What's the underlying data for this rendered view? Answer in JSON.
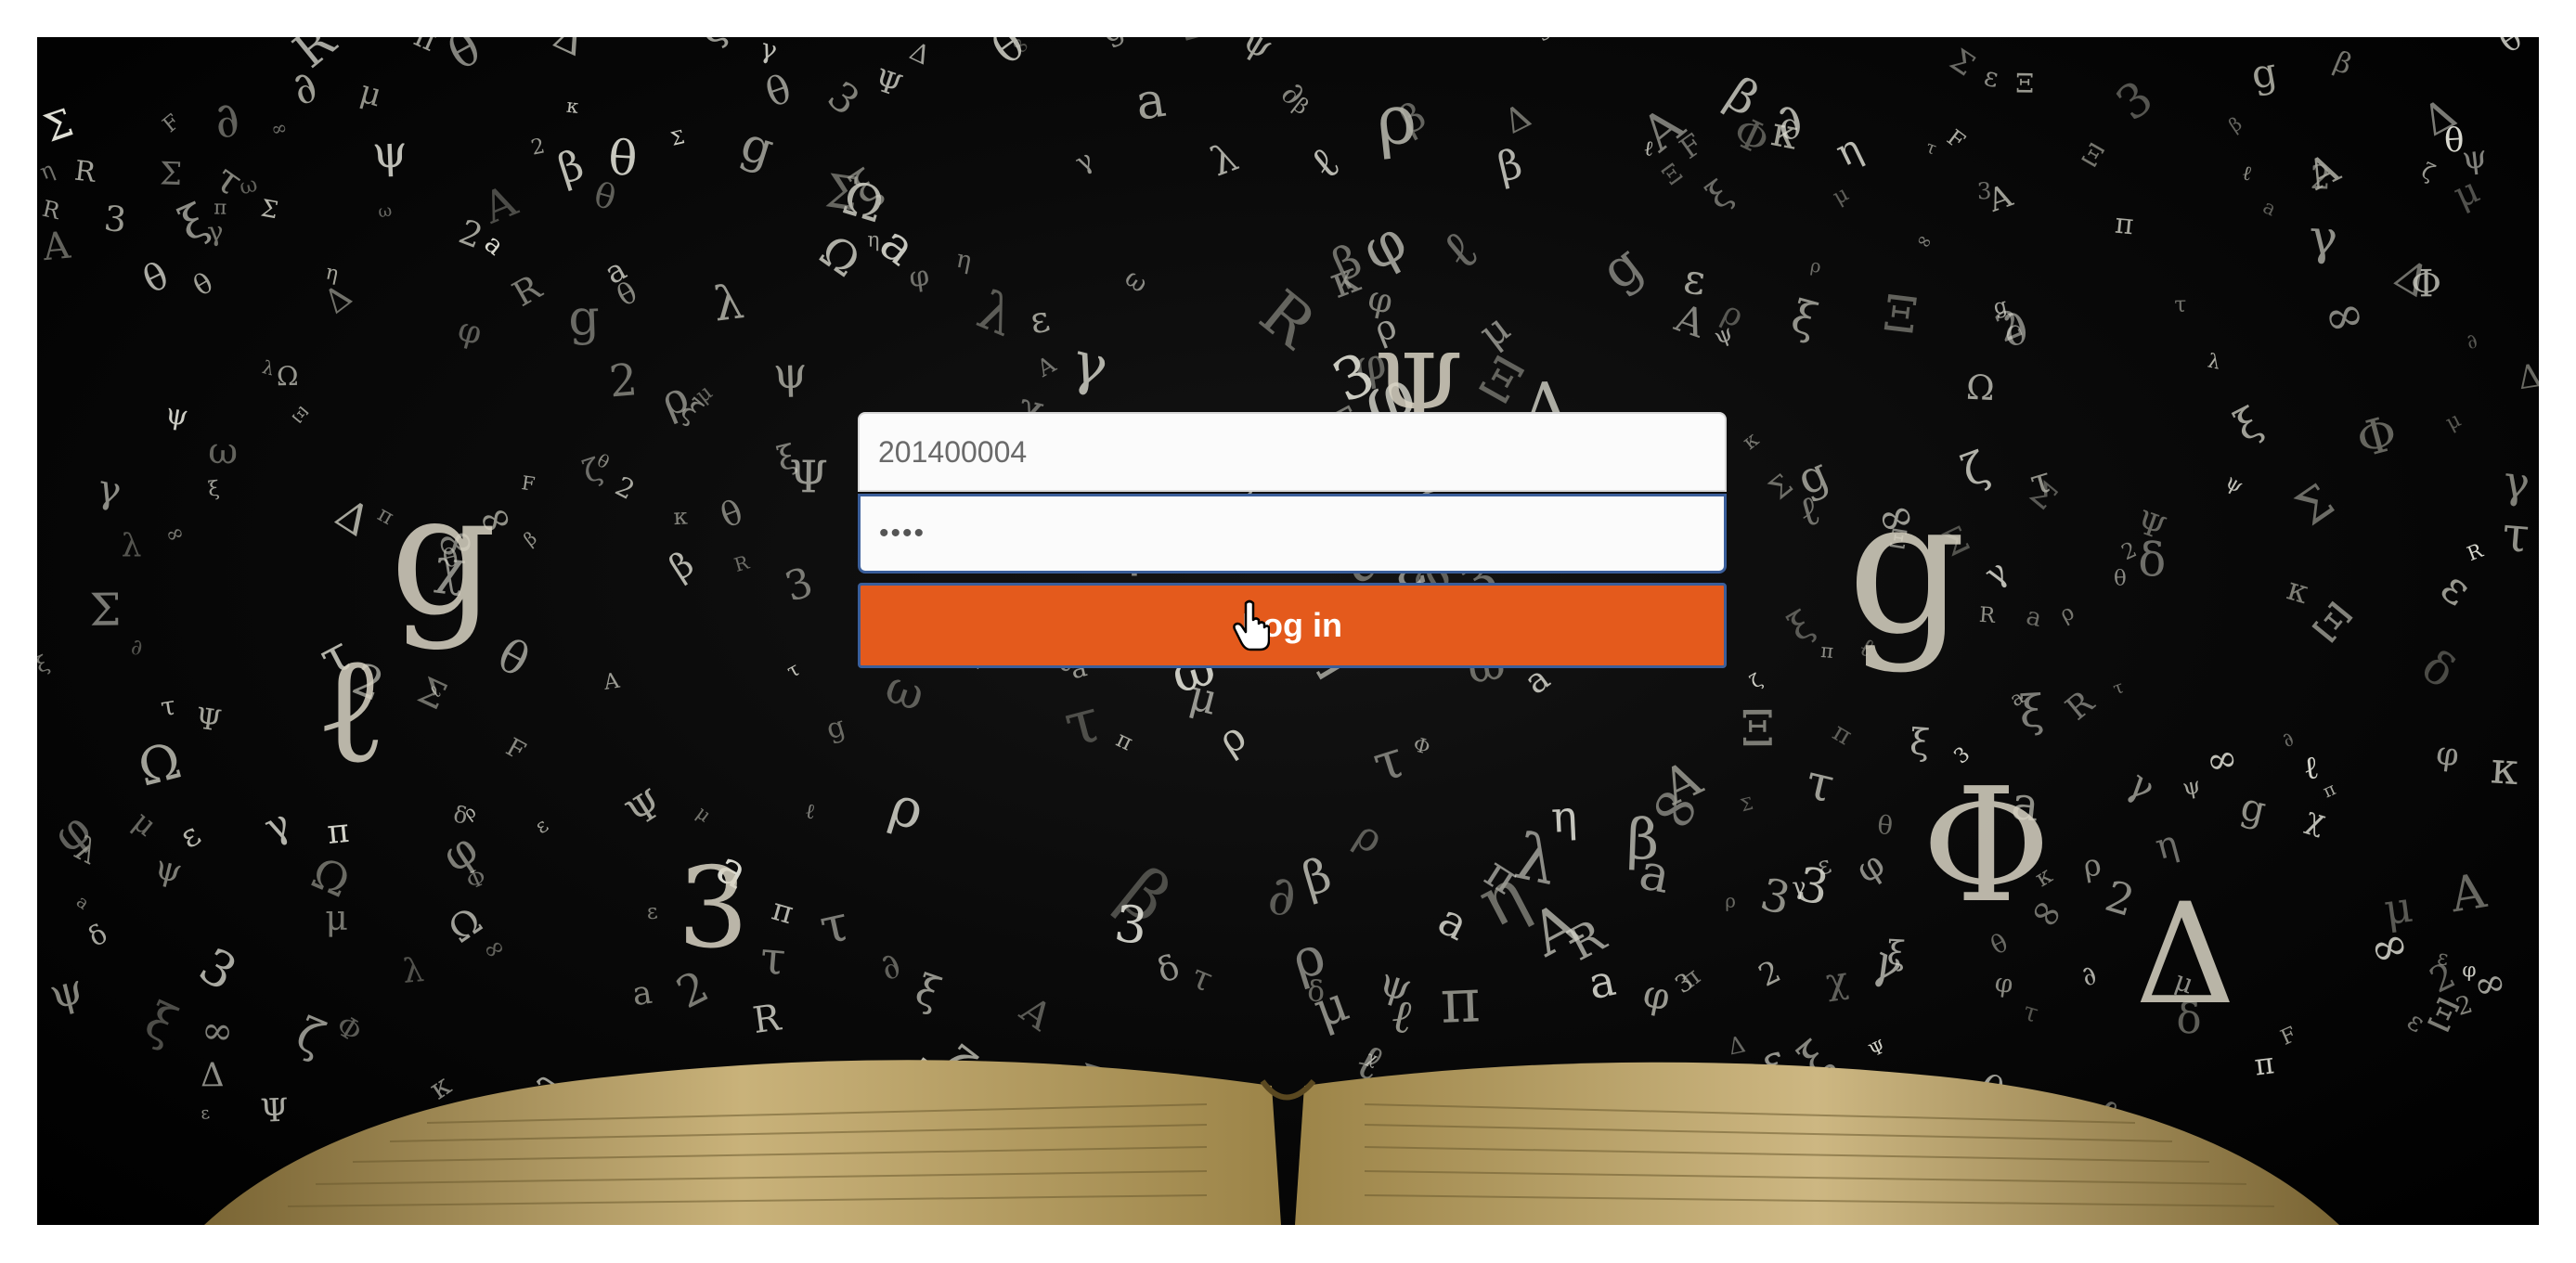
{
  "login": {
    "username_value": "201400004",
    "password_mask": "••••",
    "button_label": "Log in"
  },
  "colors": {
    "button": "#e45a1c",
    "focus_border": "#3a5e9a",
    "background": "#000000"
  },
  "icons": {
    "cursor": "hand-pointer-icon"
  }
}
